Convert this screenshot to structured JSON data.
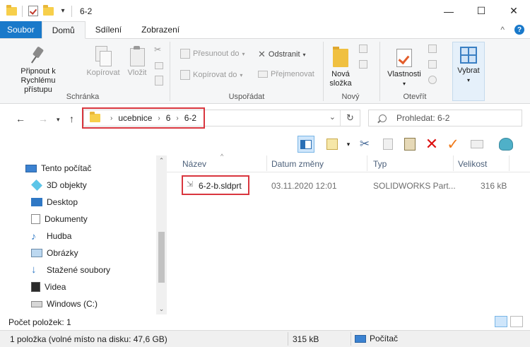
{
  "window": {
    "title": "6-2",
    "min_glyph": "—",
    "max_glyph": "☐",
    "close_glyph": "✕",
    "qa_menu_glyph": "▾"
  },
  "tabs": [
    {
      "label": "Soubor"
    },
    {
      "label": "Domů"
    },
    {
      "label": "Sdílení"
    },
    {
      "label": "Zobrazení"
    }
  ],
  "tabs_right": {
    "collapse_glyph": "^",
    "help_glyph": "?"
  },
  "ribbon": {
    "clipboard": {
      "pin_label": "Připnout k Rychlému přístupu",
      "copy_label": "Kopírovat",
      "paste_label": "Vložit",
      "group_label": "Schránka"
    },
    "organize": {
      "move_label": "Přesunout do",
      "copy_to_label": "Kopírovat do",
      "delete_label": "Odstranit",
      "rename_label": "Přejmenovat",
      "group_label": "Uspořádat"
    },
    "new": {
      "new_folder_label": "Nová složka",
      "group_label": "Nový"
    },
    "open": {
      "properties_label": "Vlastnosti",
      "group_label": "Otevřít"
    },
    "select": {
      "select_label": "Vybrat"
    }
  },
  "address": {
    "crumbs": [
      "ucebnice",
      "6",
      "6-2"
    ],
    "search_placeholder": "Prohledat: 6-2"
  },
  "nav_pane": {
    "items": [
      {
        "label": "Tento počítač",
        "icon": "computer-icon"
      },
      {
        "label": "3D objekty",
        "icon": "3d-objects-icon"
      },
      {
        "label": "Desktop",
        "icon": "desktop-icon"
      },
      {
        "label": "Dokumenty",
        "icon": "documents-icon"
      },
      {
        "label": "Hudba",
        "icon": "music-icon"
      },
      {
        "label": "Obrázky",
        "icon": "pictures-icon"
      },
      {
        "label": "Stažené soubory",
        "icon": "downloads-icon"
      },
      {
        "label": "Videa",
        "icon": "videos-icon"
      },
      {
        "label": "Windows (C:)",
        "icon": "drive-icon"
      }
    ]
  },
  "file_list": {
    "columns": [
      "Název",
      "Datum změny",
      "Typ",
      "Velikost"
    ],
    "rows": [
      {
        "name": "6-2-b.sldprt",
        "date": "03.11.2020 12:01",
        "type": "SOLIDWORKS Part...",
        "size": "316 kB"
      }
    ]
  },
  "status": {
    "item_count": "Počet položek: 1",
    "selection_info": "1 položka (volné místo na disku: 47,6 GB)",
    "selection_size": "315 kB",
    "location": "Počítač"
  },
  "colors": {
    "accent": "#1979ca",
    "highlight_red": "#d9363e"
  }
}
